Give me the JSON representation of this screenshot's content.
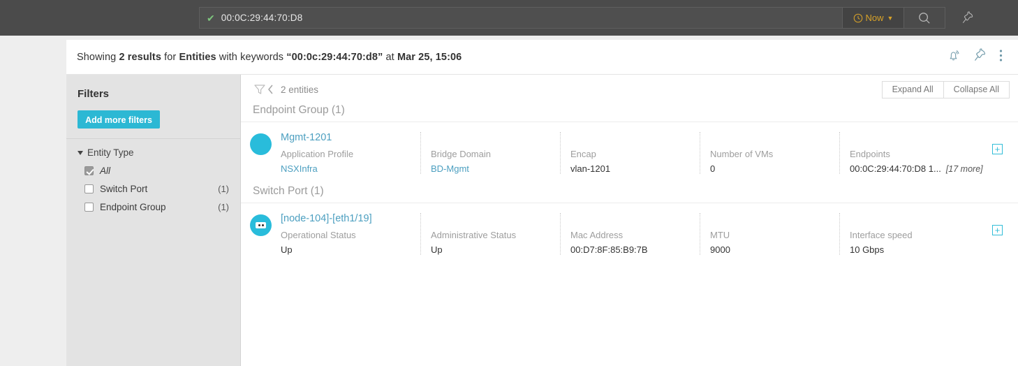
{
  "topbar": {
    "search_value": "00:0C:29:44:70:D8",
    "check_icon": "check-icon",
    "time_label": "Now",
    "time_icon": "clock-icon",
    "caret": "∨",
    "search_icon": "search-icon",
    "pin_icon": "pin-icon"
  },
  "results_header": {
    "showing_prefix": "Showing ",
    "count": "2 results",
    "for_word": " for ",
    "entity_word": "Entities",
    "keywords_word": " with keywords ",
    "keyword_value": "“00:0c:29:44:70:d8”",
    "at_word": " at ",
    "timestamp": "Mar 25, 15:06",
    "icons": [
      "bell-icon",
      "pin-icon",
      "kebab-menu-icon"
    ]
  },
  "filters": {
    "title": "Filters",
    "add_button": "Add more filters",
    "group_label": "Entity Type",
    "options": [
      {
        "label": "All",
        "count": "",
        "checked": true,
        "italic": true
      },
      {
        "label": "Switch Port",
        "count": "(1)",
        "checked": false,
        "italic": false
      },
      {
        "label": "Endpoint Group",
        "count": "(1)",
        "checked": false,
        "italic": false
      }
    ]
  },
  "toolbar": {
    "funnel_icon": "filter-funnel-icon",
    "entities_count": "2 entities",
    "expand_all": "Expand All",
    "collapse_all": "Collapse All"
  },
  "sections": [
    {
      "title": "Endpoint Group (1)",
      "icon": "circle-icon",
      "name": "Mgmt-1201",
      "fields": [
        {
          "label": "Application Profile",
          "value": "NSXInfra",
          "link": true
        },
        {
          "label": "Bridge Domain",
          "value": "BD-Mgmt",
          "link": true
        },
        {
          "label": "Encap",
          "value": "vlan-1201",
          "link": false
        },
        {
          "label": "Number of VMs",
          "value": "0",
          "link": false
        },
        {
          "label": "Endpoints",
          "value": "00:0C:29:44:70:D8 1...",
          "link": false,
          "more": "[17 more]"
        }
      ],
      "expand_icon": "plus-box-icon"
    },
    {
      "title": "Switch Port (1)",
      "icon": "switch-port-icon",
      "name": "[node-104]-[eth1/19]",
      "fields": [
        {
          "label": "Operational Status",
          "value": "Up",
          "link": false
        },
        {
          "label": "Administrative Status",
          "value": "Up",
          "link": false
        },
        {
          "label": "Mac Address",
          "value": "00:D7:8F:85:B9:7B",
          "link": false
        },
        {
          "label": "MTU",
          "value": "9000",
          "link": false
        },
        {
          "label": "Interface speed",
          "value": "10 Gbps",
          "link": false
        }
      ],
      "expand_icon": "plus-box-icon"
    }
  ],
  "colors": {
    "accent": "#29bcdb",
    "link": "#4c9fc0",
    "header_bg": "#4b4b4b",
    "time_text": "#d7a229",
    "check": "#7ec67e"
  }
}
